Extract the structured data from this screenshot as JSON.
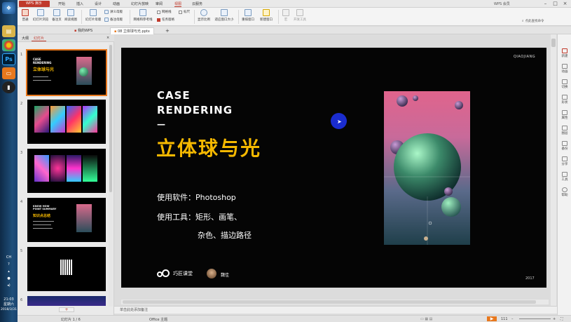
{
  "titlebar": {
    "app_name": "WPS 演示",
    "menu_tabs": [
      "开始",
      "插入",
      "设计",
      "动画",
      "幻灯片放映",
      "审阅",
      "视图",
      "云服务"
    ],
    "active_tab": "视图",
    "user": "WPS 会员"
  },
  "ribbon": {
    "items": [
      {
        "label": "普通"
      },
      {
        "label": "幻灯片浏览"
      },
      {
        "label": "备注页"
      },
      {
        "label": "阅读视图"
      },
      {
        "label": "幻灯片母版"
      },
      {
        "label": "讲义母版"
      },
      {
        "label": "备注母版"
      },
      {
        "label": "网格和参考线"
      },
      {
        "label": "任务窗格"
      },
      {
        "label": "显示比例"
      },
      {
        "label": "适应窗口大小"
      },
      {
        "label": "重排窗口"
      },
      {
        "label": "新建窗口"
      },
      {
        "label": "宏"
      },
      {
        "label": "开发工具"
      }
    ],
    "checkboxes": [
      "网格线",
      "标尺"
    ],
    "search": "点此查找命令"
  },
  "tabbar": {
    "tabs": [
      "我的WPS",
      "08 立体球与光.pptx"
    ],
    "add_label": "+"
  },
  "pane": {
    "tabs": [
      "大纲",
      "幻灯片"
    ],
    "active_tab": "幻灯片",
    "slide_numbers": [
      "1",
      "2",
      "3",
      "4",
      "5",
      "6"
    ],
    "thumb4_lines": [
      "KNOW HOW",
      "POINT SUMMARY",
      "知识点总结"
    ]
  },
  "slide": {
    "brand": "QIAOJIANG",
    "title_en_1": "CASE",
    "title_en_2": "RENDERING",
    "dash": "—",
    "title_cn": "立体球与光",
    "software": "使用软件：Photoshop",
    "tools_1": "使用工具：矩形、画笔、",
    "tools_2": "杂色、描边路径",
    "logo_text": "巧匠课堂",
    "author": "魏佳",
    "year": "2017"
  },
  "notes": {
    "placeholder": "单击此处添加备注"
  },
  "rightpanel": {
    "items": [
      "新建",
      "动画",
      "切换",
      "形状",
      "属性",
      "图层",
      "备份",
      "分享",
      "工具",
      "帮助"
    ]
  },
  "statusbar": {
    "slide_info": "幻灯片 1 / 6",
    "theme": "Office 主题",
    "zoom": "111"
  },
  "taskbar": {
    "time": "21:03",
    "weekday": "星期六",
    "date": "2018/3/31",
    "ime": "CH"
  },
  "colors": {
    "accent": "#c0392b",
    "slide_title_cn": "#f5b800",
    "slide_bg": "#050505"
  }
}
